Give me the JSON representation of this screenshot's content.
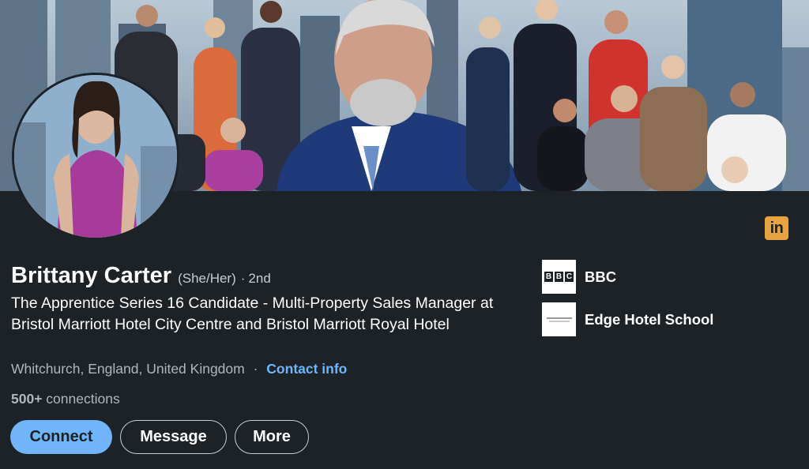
{
  "profile": {
    "name": "Brittany Carter",
    "pronouns": "(She/Her)",
    "degree_separator": "·",
    "degree": "2nd",
    "headline": "The Apprentice Series 16 Candidate - Multi-Property Sales Manager at Bristol Marriott Hotel City Centre and Bristol Marriott Royal Hotel",
    "location": "Whitchurch, England, United Kingdom",
    "location_separator": "·",
    "contact_link": "Contact info",
    "connections_count": "500+",
    "connections_label": "connections"
  },
  "actions": {
    "connect": "Connect",
    "message": "Message",
    "more": "More"
  },
  "companies": [
    {
      "name": "BBC",
      "logo_letters": [
        "B",
        "B",
        "C"
      ]
    },
    {
      "name": "Edge Hotel School"
    }
  ],
  "badge": {
    "text": "in",
    "icon": "linkedin-icon"
  },
  "colors": {
    "background": "#1d2226",
    "primary_button": "#70b5f9",
    "link": "#70b5f9",
    "secondary_text": "#b0b6bb",
    "linkedin_badge": "#e7a33e"
  }
}
